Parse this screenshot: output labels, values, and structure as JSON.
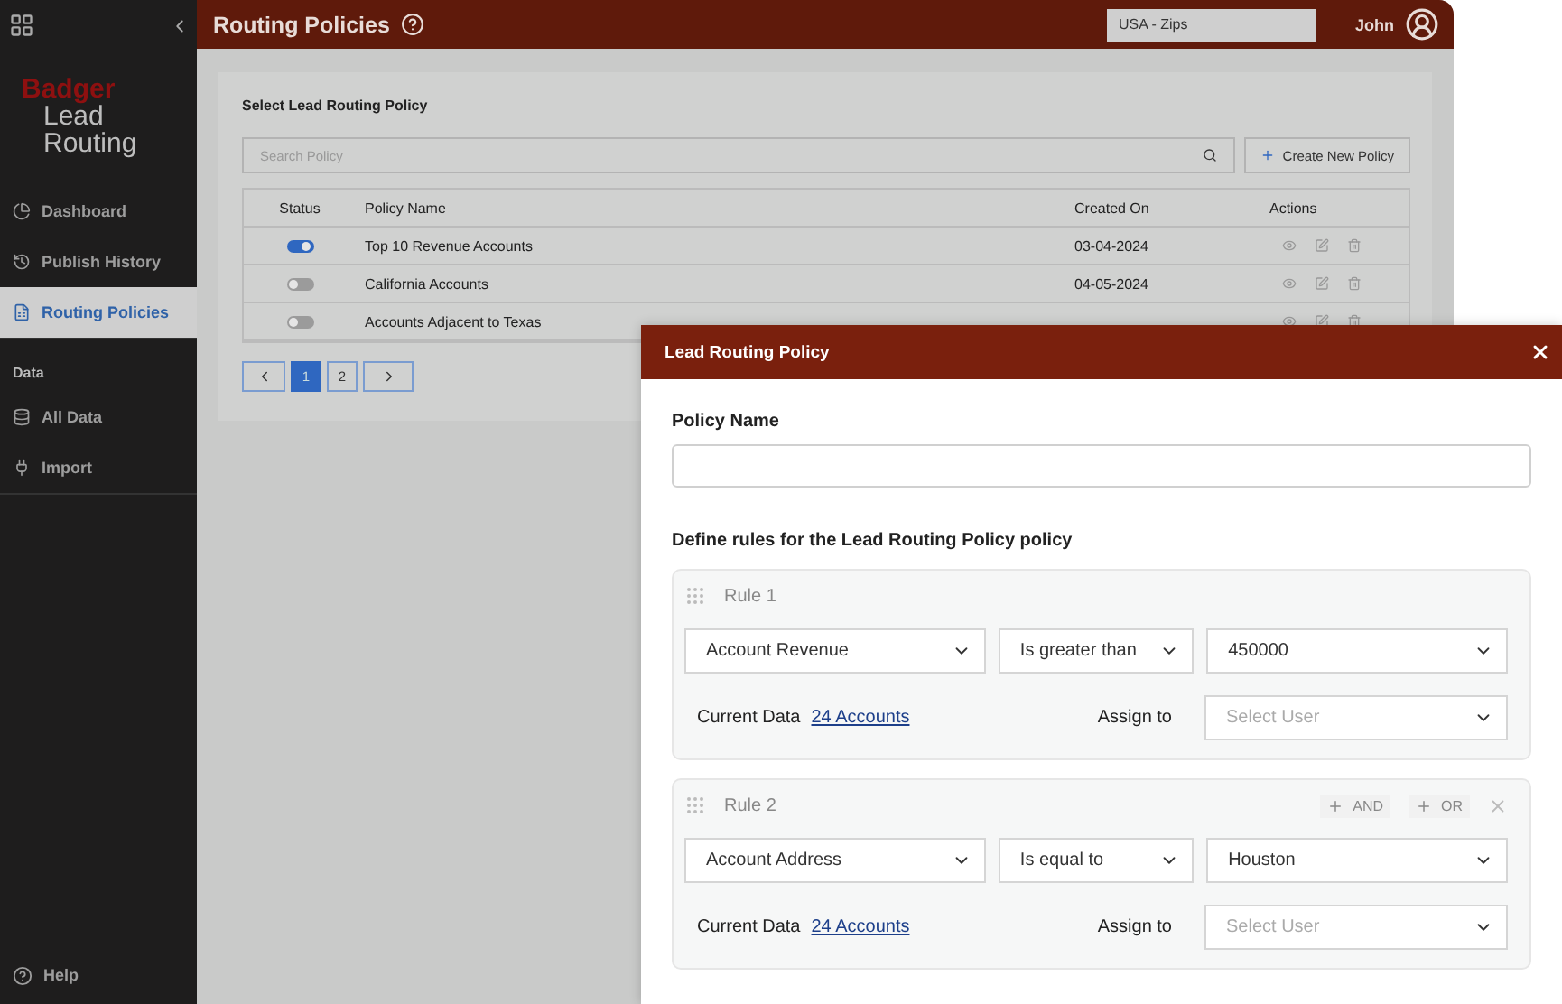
{
  "sidebar": {
    "logo": [
      "Badger",
      "Lead",
      "Routing"
    ],
    "items": [
      {
        "label": "Dashboard",
        "selected": false
      },
      {
        "label": "Publish History",
        "selected": false
      },
      {
        "label": "Routing Policies",
        "selected": true
      }
    ],
    "section": "Data",
    "data_items": [
      {
        "label": "All Data",
        "selected": false
      },
      {
        "label": "Import",
        "selected": false
      }
    ],
    "help": "Help"
  },
  "header": {
    "title": "Routing Policies",
    "region": "USA - Zips",
    "user": "John"
  },
  "panel": {
    "title": "Select Lead Routing Policy",
    "search_placeholder": "Search Policy",
    "create_button": "Create New Policy",
    "columns": [
      "Status",
      "Policy Name",
      "Created On",
      "Actions"
    ],
    "rows": [
      {
        "on": true,
        "name": "Top 10 Revenue Accounts",
        "created": "03-04-2024"
      },
      {
        "on": false,
        "name": "California Accounts",
        "created": "04-05-2024"
      },
      {
        "on": false,
        "name": "Accounts Adjacent to Texas"
      }
    ],
    "pages": [
      {
        "label": "1",
        "selected": true
      },
      {
        "label": "2",
        "selected": false
      }
    ]
  },
  "dialog": {
    "title": "Lead Routing Policy",
    "name_label": "Policy Name",
    "rules_heading": "Define rules for the Lead Routing Policy policy",
    "rules": [
      {
        "title": "Rule 1",
        "field": "Account Revenue",
        "operator": "Is greater than",
        "value": "450000",
        "data_label": "Current Data",
        "data_link": "24 Accounts",
        "assign_label": "Assign to",
        "assign_placeholder": "Select User"
      },
      {
        "title": "Rule 2",
        "field": "Account Address",
        "operator": "Is equal to",
        "value": "Houston",
        "data_label": "Current Data",
        "data_link": "24 Accounts",
        "assign_label": "Assign to",
        "assign_placeholder": "Select User",
        "actions": [
          "AND",
          "OR"
        ]
      }
    ]
  }
}
